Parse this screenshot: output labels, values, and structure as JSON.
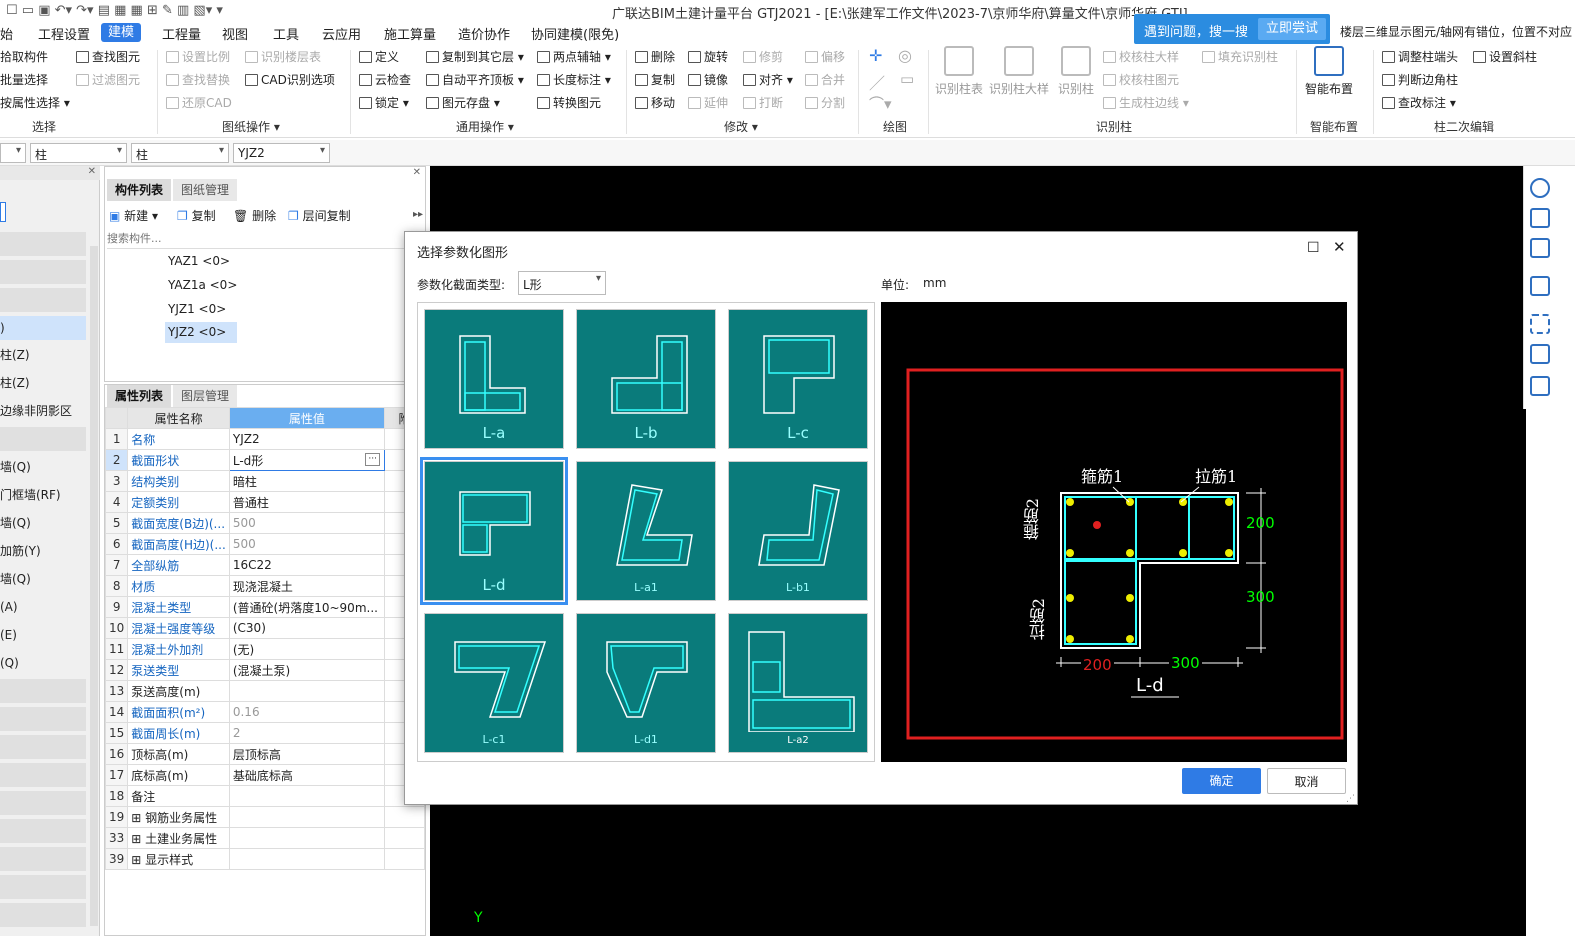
{
  "app": {
    "title": "广联达BIM土建计量平台 GTJ2021 - [E:\\张建军工作文件\\2023-7\\京师华府\\算量文件\\京师华府.GTJ]"
  },
  "help": {
    "text": "遇到问题，搜一搜",
    "button": "立即尝试"
  },
  "notice": "楼层三维显示图元/轴网有错位，位置不对应",
  "tabs": [
    "始",
    "工程设置",
    "建模",
    "工程量",
    "视图",
    "工具",
    "云应用",
    "施工算量",
    "造价协作",
    "协同建模(限免)"
  ],
  "ribbon": {
    "select": [
      "拾取构件",
      "批量选择",
      "按属性选择"
    ],
    "select_find": [
      "查找图元",
      "过滤图元"
    ],
    "drawing": [
      "设置比例",
      "查找替换",
      "还原CAD",
      "识别楼层表",
      "CAD识别选项"
    ],
    "general": [
      "定义",
      "云检查",
      "锁定",
      "复制到其它层",
      "自动平齐顶板",
      "图元存盘",
      "两点辅轴",
      "长度标注",
      "转换图元"
    ],
    "modify": [
      "删除",
      "复制",
      "移动",
      "旋转",
      "镜像",
      "对齐",
      "修剪",
      "延伸",
      "打断",
      "偏移",
      "合并",
      "分割"
    ],
    "identify": [
      "识别柱表",
      "识别柱大样",
      "识别柱",
      "校核柱大样",
      "校核柱图元",
      "生成柱边线",
      "填充识别柱"
    ],
    "smart": "智能布置",
    "edit2": [
      "调整柱端头",
      "判断边角柱",
      "查改标注",
      "设置斜柱"
    ],
    "groups": [
      "选择",
      "图纸操作",
      "通用操作",
      "修改",
      "绘图",
      "识别柱",
      "智能布置",
      "柱二次编辑"
    ]
  },
  "selbar": {
    "s1": "柱",
    "s2": "柱",
    "s3": "YJZ2"
  },
  "leftnav": [
    "柱(Z)",
    "柱(Z)",
    "边缘非阴影区(Z)",
    "墙(Q)",
    "门框墙(RF)",
    "墙(Q)",
    "加筋(Y)",
    "墙(Q)",
    "(A)",
    "(E)",
    "(Q)"
  ],
  "comp": {
    "tab1": "构件列表",
    "tab2": "图纸管理",
    "new": "新建",
    "copy": "复制",
    "del": "删除",
    "floorcopy": "层间复制",
    "search": "搜索构件...",
    "items": [
      "YAZ1 <0>",
      "YAZ1a <0>",
      "YJZ1 <0>",
      "YJZ2 <0>"
    ]
  },
  "prop": {
    "tab1": "属性列表",
    "tab2": "图层管理",
    "h_name": "属性名称",
    "h_val": "属性值",
    "h_add": "附",
    "rows": [
      {
        "n": "1",
        "k": "名称",
        "v": "YJZ2"
      },
      {
        "n": "2",
        "k": "截面形状",
        "v": "L-d形"
      },
      {
        "n": "3",
        "k": "结构类别",
        "v": "暗柱"
      },
      {
        "n": "4",
        "k": "定额类别",
        "v": "普通柱"
      },
      {
        "n": "5",
        "k": "截面宽度(B边)(...",
        "v": "500"
      },
      {
        "n": "6",
        "k": "截面高度(H边)(...",
        "v": "500"
      },
      {
        "n": "7",
        "k": "全部纵筋",
        "v": "16C22"
      },
      {
        "n": "8",
        "k": "材质",
        "v": "现浇混凝土"
      },
      {
        "n": "9",
        "k": "混凝土类型",
        "v": "(普通砼(坍落度10~90m..."
      },
      {
        "n": "10",
        "k": "混凝土强度等级",
        "v": "(C30)"
      },
      {
        "n": "11",
        "k": "混凝土外加剂",
        "v": "(无)"
      },
      {
        "n": "12",
        "k": "泵送类型",
        "v": "(混凝土泵)"
      },
      {
        "n": "13",
        "k": "泵送高度(m)",
        "v": ""
      },
      {
        "n": "14",
        "k": "截面面积(m²)",
        "v": "0.16"
      },
      {
        "n": "15",
        "k": "截面周长(m)",
        "v": "2"
      },
      {
        "n": "16",
        "k": "顶标高(m)",
        "v": "层顶标高"
      },
      {
        "n": "17",
        "k": "底标高(m)",
        "v": "基础底标高"
      },
      {
        "n": "18",
        "k": "备注",
        "v": ""
      },
      {
        "n": "19",
        "k": "钢筋业务属性",
        "v": ""
      },
      {
        "n": "33",
        "k": "土建业务属性",
        "v": ""
      },
      {
        "n": "39",
        "k": "显示样式",
        "v": ""
      }
    ]
  },
  "dialog": {
    "title": "选择参数化图形",
    "type_label": "参数化截面类型:",
    "type_value": "L形",
    "unit_label": "单位:",
    "unit_value": "mm",
    "thumbs": [
      "L-a",
      "L-b",
      "L-c",
      "L-d",
      "L-a1",
      "L-b1",
      "L-c1",
      "L-d1",
      "L-a2"
    ],
    "preview": {
      "name": "L-d",
      "label_hoop1": "箍筋1",
      "label_tie1": "拉筋1",
      "label_hoop2": "箍筋2",
      "label_tie2": "拉筋2",
      "dim_r1": "200",
      "dim_r2": "300",
      "dim_b1": "200",
      "dim_b2": "300"
    },
    "ok": "确定",
    "cancel": "取消"
  }
}
